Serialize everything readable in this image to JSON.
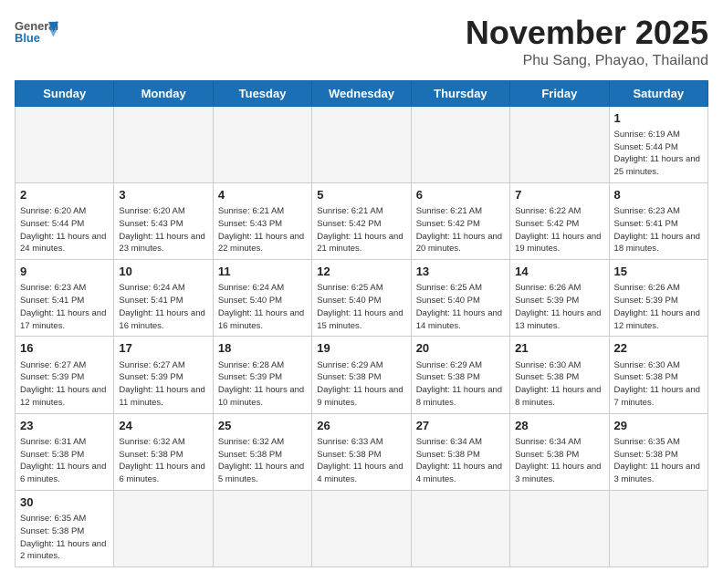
{
  "header": {
    "logo_general": "General",
    "logo_blue": "Blue",
    "month_title": "November 2025",
    "subtitle": "Phu Sang, Phayao, Thailand"
  },
  "weekdays": [
    "Sunday",
    "Monday",
    "Tuesday",
    "Wednesday",
    "Thursday",
    "Friday",
    "Saturday"
  ],
  "weeks": [
    [
      {
        "day": "",
        "info": ""
      },
      {
        "day": "",
        "info": ""
      },
      {
        "day": "",
        "info": ""
      },
      {
        "day": "",
        "info": ""
      },
      {
        "day": "",
        "info": ""
      },
      {
        "day": "",
        "info": ""
      },
      {
        "day": "1",
        "info": "Sunrise: 6:19 AM\nSunset: 5:44 PM\nDaylight: 11 hours\nand 25 minutes."
      }
    ],
    [
      {
        "day": "2",
        "info": "Sunrise: 6:20 AM\nSunset: 5:44 PM\nDaylight: 11 hours\nand 24 minutes."
      },
      {
        "day": "3",
        "info": "Sunrise: 6:20 AM\nSunset: 5:43 PM\nDaylight: 11 hours\nand 23 minutes."
      },
      {
        "day": "4",
        "info": "Sunrise: 6:21 AM\nSunset: 5:43 PM\nDaylight: 11 hours\nand 22 minutes."
      },
      {
        "day": "5",
        "info": "Sunrise: 6:21 AM\nSunset: 5:42 PM\nDaylight: 11 hours\nand 21 minutes."
      },
      {
        "day": "6",
        "info": "Sunrise: 6:21 AM\nSunset: 5:42 PM\nDaylight: 11 hours\nand 20 minutes."
      },
      {
        "day": "7",
        "info": "Sunrise: 6:22 AM\nSunset: 5:42 PM\nDaylight: 11 hours\nand 19 minutes."
      },
      {
        "day": "8",
        "info": "Sunrise: 6:23 AM\nSunset: 5:41 PM\nDaylight: 11 hours\nand 18 minutes."
      }
    ],
    [
      {
        "day": "9",
        "info": "Sunrise: 6:23 AM\nSunset: 5:41 PM\nDaylight: 11 hours\nand 17 minutes."
      },
      {
        "day": "10",
        "info": "Sunrise: 6:24 AM\nSunset: 5:41 PM\nDaylight: 11 hours\nand 16 minutes."
      },
      {
        "day": "11",
        "info": "Sunrise: 6:24 AM\nSunset: 5:40 PM\nDaylight: 11 hours\nand 16 minutes."
      },
      {
        "day": "12",
        "info": "Sunrise: 6:25 AM\nSunset: 5:40 PM\nDaylight: 11 hours\nand 15 minutes."
      },
      {
        "day": "13",
        "info": "Sunrise: 6:25 AM\nSunset: 5:40 PM\nDaylight: 11 hours\nand 14 minutes."
      },
      {
        "day": "14",
        "info": "Sunrise: 6:26 AM\nSunset: 5:39 PM\nDaylight: 11 hours\nand 13 minutes."
      },
      {
        "day": "15",
        "info": "Sunrise: 6:26 AM\nSunset: 5:39 PM\nDaylight: 11 hours\nand 12 minutes."
      }
    ],
    [
      {
        "day": "16",
        "info": "Sunrise: 6:27 AM\nSunset: 5:39 PM\nDaylight: 11 hours\nand 12 minutes."
      },
      {
        "day": "17",
        "info": "Sunrise: 6:27 AM\nSunset: 5:39 PM\nDaylight: 11 hours\nand 11 minutes."
      },
      {
        "day": "18",
        "info": "Sunrise: 6:28 AM\nSunset: 5:39 PM\nDaylight: 11 hours\nand 10 minutes."
      },
      {
        "day": "19",
        "info": "Sunrise: 6:29 AM\nSunset: 5:38 PM\nDaylight: 11 hours\nand 9 minutes."
      },
      {
        "day": "20",
        "info": "Sunrise: 6:29 AM\nSunset: 5:38 PM\nDaylight: 11 hours\nand 8 minutes."
      },
      {
        "day": "21",
        "info": "Sunrise: 6:30 AM\nSunset: 5:38 PM\nDaylight: 11 hours\nand 8 minutes."
      },
      {
        "day": "22",
        "info": "Sunrise: 6:30 AM\nSunset: 5:38 PM\nDaylight: 11 hours\nand 7 minutes."
      }
    ],
    [
      {
        "day": "23",
        "info": "Sunrise: 6:31 AM\nSunset: 5:38 PM\nDaylight: 11 hours\nand 6 minutes."
      },
      {
        "day": "24",
        "info": "Sunrise: 6:32 AM\nSunset: 5:38 PM\nDaylight: 11 hours\nand 6 minutes."
      },
      {
        "day": "25",
        "info": "Sunrise: 6:32 AM\nSunset: 5:38 PM\nDaylight: 11 hours\nand 5 minutes."
      },
      {
        "day": "26",
        "info": "Sunrise: 6:33 AM\nSunset: 5:38 PM\nDaylight: 11 hours\nand 4 minutes."
      },
      {
        "day": "27",
        "info": "Sunrise: 6:34 AM\nSunset: 5:38 PM\nDaylight: 11 hours\nand 4 minutes."
      },
      {
        "day": "28",
        "info": "Sunrise: 6:34 AM\nSunset: 5:38 PM\nDaylight: 11 hours\nand 3 minutes."
      },
      {
        "day": "29",
        "info": "Sunrise: 6:35 AM\nSunset: 5:38 PM\nDaylight: 11 hours\nand 3 minutes."
      }
    ],
    [
      {
        "day": "30",
        "info": "Sunrise: 6:35 AM\nSunset: 5:38 PM\nDaylight: 11 hours\nand 2 minutes."
      },
      {
        "day": "",
        "info": ""
      },
      {
        "day": "",
        "info": ""
      },
      {
        "day": "",
        "info": ""
      },
      {
        "day": "",
        "info": ""
      },
      {
        "day": "",
        "info": ""
      },
      {
        "day": "",
        "info": ""
      }
    ]
  ]
}
